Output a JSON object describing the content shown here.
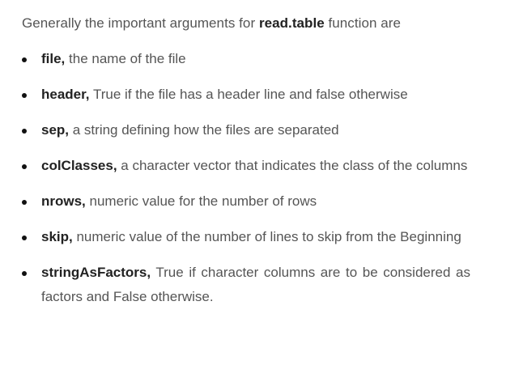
{
  "intro": {
    "before": "Generally the important arguments for ",
    "bold": "read.table",
    "after": " function are"
  },
  "items": [
    {
      "term": "file,",
      "desc": " the name of the file"
    },
    {
      "term": "header,",
      "desc": " True if the file has a header line and false otherwise"
    },
    {
      "term": "sep,",
      "desc": " a string defining how the files are separated"
    },
    {
      "term": "colClasses,",
      "desc": " a character vector that indicates the class of the columns"
    },
    {
      "term": "nrows,",
      "desc": " numeric value for the number of rows"
    },
    {
      "term": "skip,",
      "desc": " numeric value of the number of lines to skip from the Beginning"
    },
    {
      "term": "stringAsFactors,",
      "desc": " True if character columns are to be considered as factors and False otherwise."
    }
  ]
}
